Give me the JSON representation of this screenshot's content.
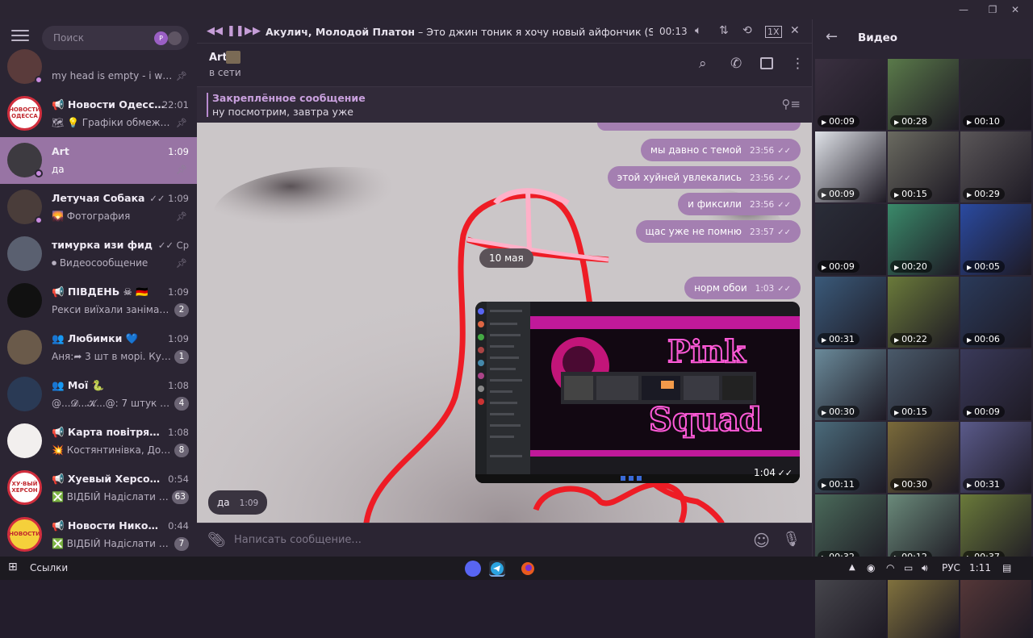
{
  "window": {
    "minimize": "—",
    "maximize": "❐",
    "close": "✕"
  },
  "search": {
    "placeholder": "Поиск",
    "avatar_letter": "P"
  },
  "chats": [
    {
      "name": "",
      "time": "",
      "msg": "my head is empty - i was ...",
      "pinned": true,
      "dot": true,
      "color": "#5a3b3b"
    },
    {
      "name": "📢 Новости Одесса | ...",
      "time": "22:01",
      "msg": "🗺 💡 Графіки обмеже...",
      "pinned": true,
      "color": "#ffffff",
      "label": "НОВОСТИ ОДЕССА"
    },
    {
      "name": "Art",
      "time": "1:09",
      "msg": "да",
      "pinned": true,
      "dot": true,
      "active": true,
      "color": "#3d3a40"
    },
    {
      "name": "Летучая Собака",
      "time": "✓✓ 1:09",
      "msg": "🌄 Фотография",
      "pinned": true,
      "dot": true,
      "color": "#4a3d3a"
    },
    {
      "name": "тимурка изи фид",
      "time": "✓✓ Ср",
      "msg": "⏺ Видеосообщение",
      "pinned": true,
      "color": "#5a6070"
    },
    {
      "name": "📢 ПІВДЕНЬ ☠ 🇩🇪",
      "time": "1:09",
      "msg": "Рекси виїхали занімать ...",
      "badge": "2",
      "color": "#111111"
    },
    {
      "name": "👥 Любимки 💙",
      "time": "1:09",
      "msg": "Аня:➦ 3 шт в морі. Курс...",
      "badge": "1",
      "color": "#6a5a4a"
    },
    {
      "name": "👥 Мої 🐍",
      "time": "1:08",
      "msg": "@...𝓓...𝓚...@: 7 штук гус...",
      "badge": "4",
      "color": "#2a3a55"
    },
    {
      "name": "📢 Карта повітряних ...",
      "time": "1:08",
      "msg": "💥 Костянтинівка, Доне...",
      "badge": "8",
      "color": "#f2efee"
    },
    {
      "name": "📢 Хуевый Херсон 🇺🇦",
      "time": "0:54",
      "msg": "❎ ВІДБІЙ  Надіслати н...",
      "badge": "63",
      "color": "#ffffff",
      "label": "ХУ·ВЫЙ ХЕРСОН"
    },
    {
      "name": "📢 Новости Николае...",
      "time": "0:44",
      "msg": "❎ ВІДБІЙ  Надіслати н...",
      "badge": "7",
      "color": "#f5d03b",
      "label": "НОВОСТИ"
    }
  ],
  "player": {
    "artist": "Акулич, Молодой Платон",
    "song": " – Это джин тоник я хочу новый айфончик (Speed Up)",
    "time": "00:13",
    "speed": "1X"
  },
  "chat": {
    "name": "Art",
    "status": "в сети"
  },
  "pinned": {
    "label": "Закреплённое сообщение",
    "text": "ну посмотрим, завтра уже"
  },
  "messages": [
    {
      "text": "мы давно с темой",
      "time": "23:56"
    },
    {
      "text": "этой хуйней увлекались",
      "time": "23:56"
    },
    {
      "text": "и фиксили",
      "time": "23:56"
    },
    {
      "text": "щас уже не помню",
      "time": "23:57"
    }
  ],
  "date_sep": "10 мая",
  "msg_oboi": {
    "text": "норм обои",
    "time": "1:03"
  },
  "media_msg": {
    "time": "1:04",
    "art_text": "Pink Squad"
  },
  "incoming": {
    "text": "да",
    "time": "1:09"
  },
  "composer": {
    "placeholder": "Написать сообщение..."
  },
  "panel": {
    "title": "Видео"
  },
  "videos": [
    {
      "d": "00:09",
      "c": "#3a3040"
    },
    {
      "d": "00:28",
      "c": "#5a7a4a"
    },
    {
      "d": "00:10",
      "c": "#2a2830"
    },
    {
      "d": "00:09",
      "c": "#dfe2e8"
    },
    {
      "d": "00:15",
      "c": "#6a6a60"
    },
    {
      "d": "00:29",
      "c": "#5a5658"
    },
    {
      "d": "00:09",
      "c": "#2a2d38"
    },
    {
      "d": "00:20",
      "c": "#3a8a6a"
    },
    {
      "d": "00:05",
      "c": "#2a4aa0"
    },
    {
      "d": "00:31",
      "c": "#3a5a7a"
    },
    {
      "d": "00:22",
      "c": "#6a7a3a"
    },
    {
      "d": "00:06",
      "c": "#2a3a5a"
    },
    {
      "d": "00:30",
      "c": "#6a8a9a"
    },
    {
      "d": "00:15",
      "c": "#4a5a6a"
    },
    {
      "d": "00:09",
      "c": "#3a3a5a"
    },
    {
      "d": "00:11",
      "c": "#4a6a7a"
    },
    {
      "d": "00:30",
      "c": "#7a6a3a"
    },
    {
      "d": "00:31",
      "c": "#5a5a8a"
    },
    {
      "d": "00:32",
      "c": "#4a6a5a"
    },
    {
      "d": "00:12",
      "c": "#6a8a7a"
    },
    {
      "d": "00:37",
      "c": "#6a7a3a"
    },
    {
      "d": "",
      "c": "#4a4a50"
    },
    {
      "d": "",
      "c": "#8a7a40"
    },
    {
      "d": "",
      "c": "#5a3a3a"
    }
  ],
  "taskbar": {
    "start": "⊞",
    "links": "Ссылки",
    "lang": "РУС",
    "clock": "1:11"
  }
}
